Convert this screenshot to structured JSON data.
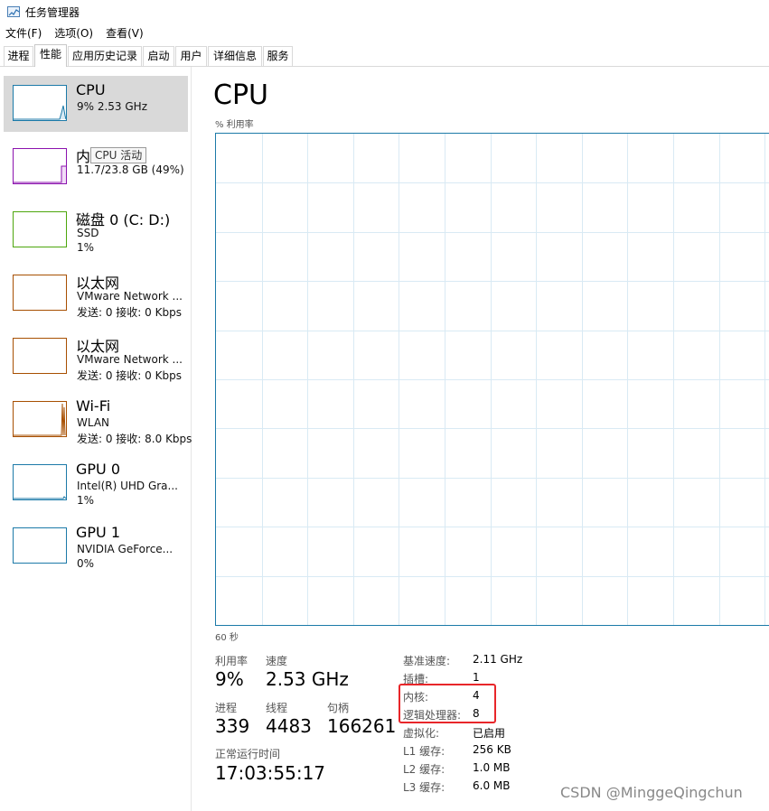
{
  "window": {
    "title": "任务管理器",
    "icon": "task-manager-icon"
  },
  "menu": [
    "文件(F)",
    "选项(O)",
    "查看(V)"
  ],
  "tabs": [
    "进程",
    "性能",
    "应用历史记录",
    "启动",
    "用户",
    "详细信息",
    "服务"
  ],
  "active_tab": "性能",
  "sidebar": [
    {
      "title": "CPU",
      "line1": "9%  2.53 GHz",
      "line2": "",
      "color": "#1c7aa8"
    },
    {
      "title": "内存",
      "line1": "11.7/23.8 GB (49%)",
      "line2": "",
      "color": "#8b12ae"
    },
    {
      "title": "磁盘 0 (C: D:)",
      "line1": "SSD",
      "line2": "1%",
      "color": "#4da60c"
    },
    {
      "title": "以太网",
      "line1": "VMware Network ...",
      "line2": "发送: 0 接收: 0 Kbps",
      "color": "#a74f01"
    },
    {
      "title": "以太网",
      "line1": "VMware Network ...",
      "line2": "发送: 0 接收: 0 Kbps",
      "color": "#a74f01"
    },
    {
      "title": "Wi-Fi",
      "line1": "WLAN",
      "line2": "发送: 0 接收: 8.0 Kbps",
      "color": "#a74f01"
    },
    {
      "title": "GPU 0",
      "line1": "Intel(R) UHD Gra...",
      "line2": "1%",
      "color": "#1c7aa8"
    },
    {
      "title": "GPU 1",
      "line1": "NVIDIA GeForce...",
      "line2": "0%",
      "color": "#1c7aa8"
    }
  ],
  "tooltip": "CPU 活动",
  "main": {
    "title": "CPU",
    "graph_label": "% 利用率",
    "graph_axis": "60 秒",
    "grid_color": "#d9eaf4",
    "line_color": "#1c7aa8"
  },
  "stats": {
    "util_label": "利用率",
    "util_value": "9%",
    "speed_label": "速度",
    "speed_value": "2.53 GHz",
    "proc_label": "进程",
    "proc_value": "339",
    "thread_label": "线程",
    "thread_value": "4483",
    "handle_label": "句柄",
    "handle_value": "166261",
    "uptime_label": "正常运行时间",
    "uptime_value": "17:03:55:17"
  },
  "specs": [
    {
      "label": "基准速度:",
      "value": "2.11 GHz"
    },
    {
      "label": "插槽:",
      "value": "1"
    },
    {
      "label": "内核:",
      "value": "4"
    },
    {
      "label": "逻辑处理器:",
      "value": "8"
    },
    {
      "label": "虚拟化:",
      "value": "已启用"
    },
    {
      "label": "L1 缓存:",
      "value": "256 KB"
    },
    {
      "label": "L2 缓存:",
      "value": "1.0 MB"
    },
    {
      "label": "L3 缓存:",
      "value": "6.0 MB"
    }
  ],
  "watermark": "CSDN @MinggeQingchun"
}
